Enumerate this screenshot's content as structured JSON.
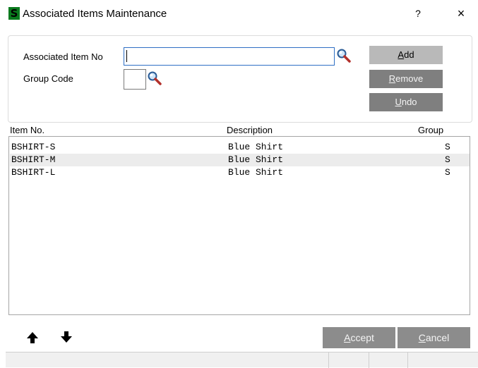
{
  "window": {
    "title": "Associated Items Maintenance",
    "app_icon_letter": "S",
    "help_label": "?",
    "close_label": "×"
  },
  "form": {
    "associated_item_label": "Associated Item No",
    "associated_item_value": "",
    "group_code_label": "Group Code",
    "group_code_value": ""
  },
  "buttons": {
    "add": {
      "accel": "A",
      "rest": "dd"
    },
    "remove": {
      "accel": "R",
      "rest": "emove"
    },
    "undo": {
      "accel": "U",
      "rest": "ndo"
    },
    "accept": {
      "accel": "A",
      "rest": "ccept"
    },
    "cancel": {
      "accel": "C",
      "rest": "ancel"
    }
  },
  "grid": {
    "columns": [
      "Item No.",
      "Description",
      "Group"
    ],
    "rows": [
      {
        "item": "BSHIRT-S",
        "description": "Blue Shirt",
        "group": "S"
      },
      {
        "item": "BSHIRT-M",
        "description": "Blue Shirt",
        "group": "S"
      },
      {
        "item": "BSHIRT-L",
        "description": "Blue Shirt",
        "group": "S"
      }
    ]
  },
  "navigation": {
    "move_up_glyph": "🡅",
    "move_down_glyph": "🡇"
  },
  "colors": {
    "app_icon": "#0a7a1e",
    "focus_border": "#2e6fc4",
    "button_enabled": "#b9b9b9",
    "button_disabled": "#7f7f7f"
  }
}
